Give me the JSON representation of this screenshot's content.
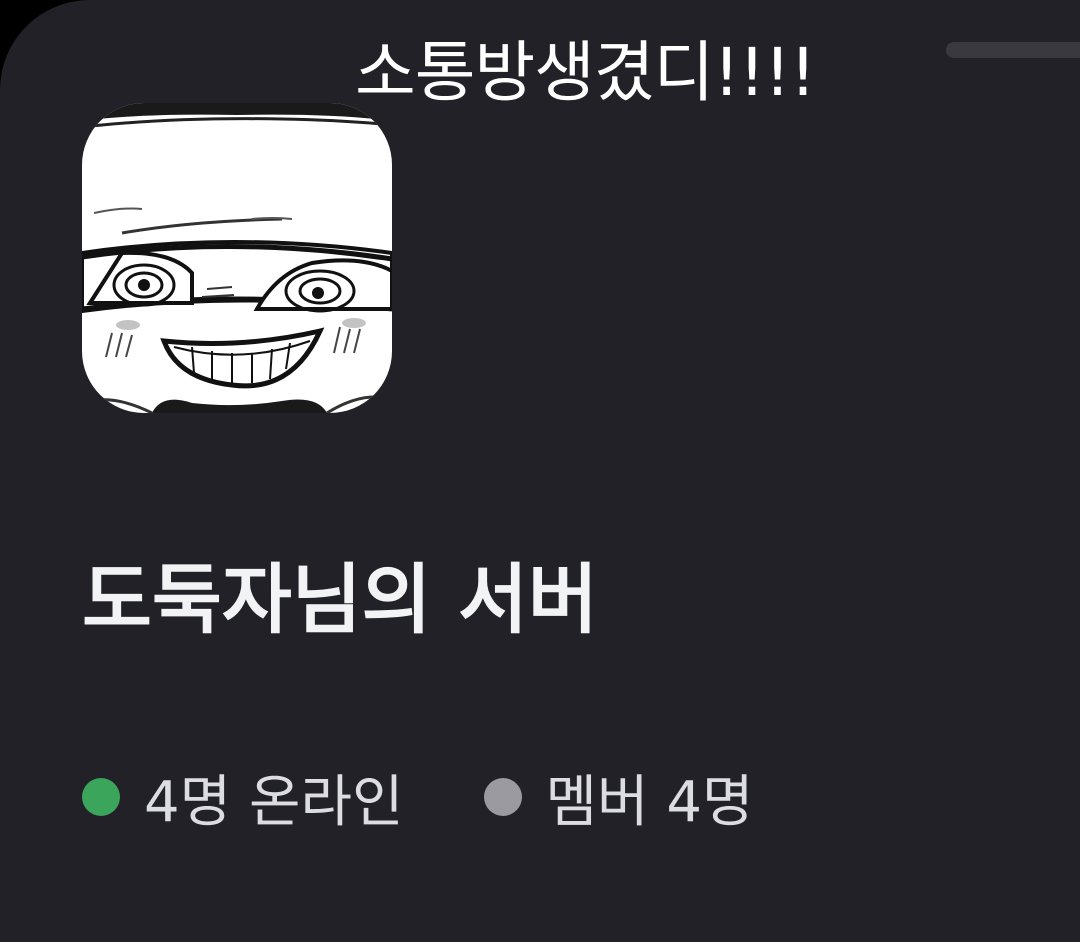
{
  "caption": "소통방생겼디!!!!",
  "server": {
    "name": "도둑자님의 서버",
    "icon": "meme-face-avatar"
  },
  "stats": {
    "online_label": "4명 온라인",
    "members_label": "멤버 4명"
  },
  "colors": {
    "background": "#222127",
    "online_dot": "#3ba55c",
    "members_dot": "#9a9aa0",
    "text": "#f2f3f5"
  }
}
